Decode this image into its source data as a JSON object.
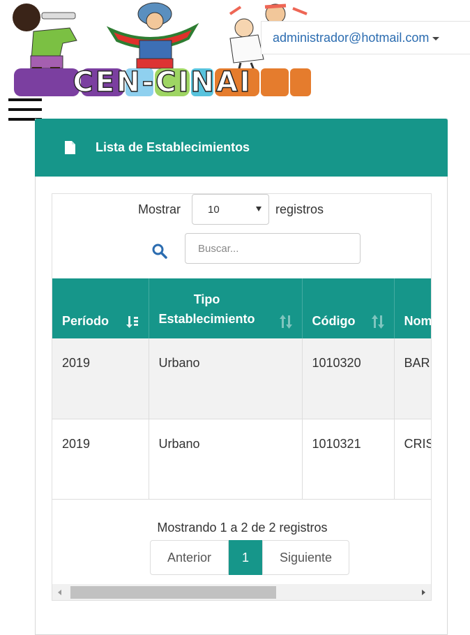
{
  "header": {
    "logo_text": "CEN-CINAI",
    "user_email": "administrador@hotmail.com"
  },
  "panel": {
    "title": "Lista de Establecimientos",
    "length": {
      "prefix": "Mostrar",
      "selected": "10",
      "suffix": "registros"
    },
    "search": {
      "placeholder": "Buscar..."
    },
    "table": {
      "columns": [
        {
          "label": "Período",
          "sort": "sorted"
        },
        {
          "label_line1": "Tipo",
          "label_line2": "Establecimiento",
          "sort": "sortable"
        },
        {
          "label": "Código",
          "sort": "sortable"
        },
        {
          "label": "Nom",
          "sort": "sortable"
        }
      ],
      "rows": [
        {
          "periodo": "2019",
          "tipo": "Urbano",
          "codigo": "1010320",
          "nombre": "BAR CUE"
        },
        {
          "periodo": "2019",
          "tipo": "Urbano",
          "codigo": "1010321",
          "nombre": "CRIS REY"
        }
      ]
    },
    "info": "Mostrando 1 a 2 de 2 registros",
    "pagination": {
      "previous": "Anterior",
      "current": "1",
      "next": "Siguiente"
    }
  },
  "colors": {
    "accent": "#16968a",
    "link": "#2b6cb0"
  }
}
